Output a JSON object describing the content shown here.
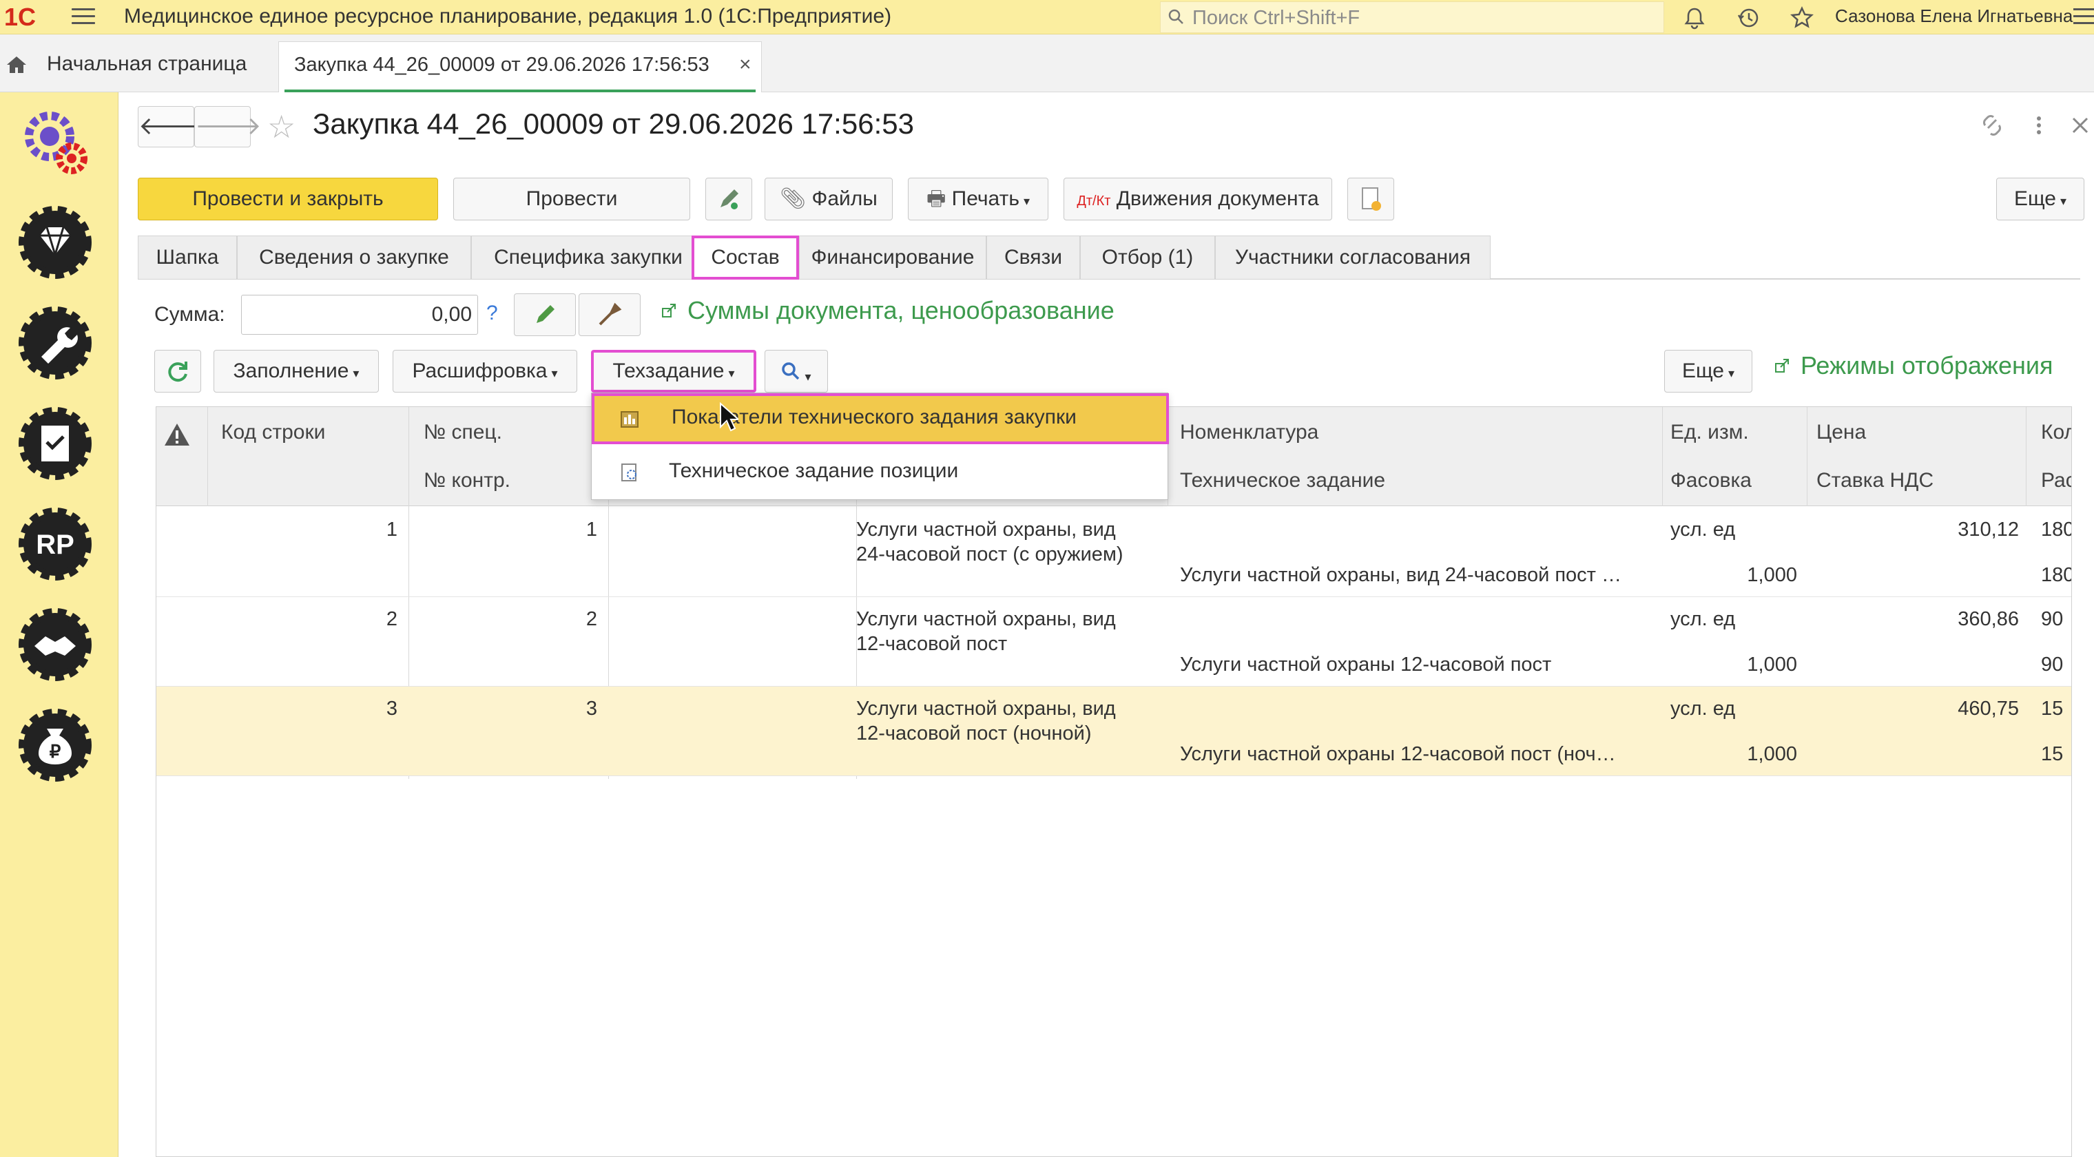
{
  "app": {
    "logo": "1С",
    "title": "Медицинское единое ресурсное планирование, редакция 1.0  (1С:Предприятие)",
    "search_placeholder": "Поиск Ctrl+Shift+F",
    "user": "Сазонова Елена Игнатьевна"
  },
  "tabs": {
    "home": "Начальная страница",
    "document": "Закупка 44_26_00009 от 29.06.2026 17:56:53",
    "close": "×"
  },
  "sidebar": {
    "items": [
      "settings-gear-icon",
      "diamond-gear-icon",
      "wrench-gear-icon",
      "document-gear-icon",
      "rp-gear-icon",
      "handshake-gear-icon",
      "money-bag-gear-icon"
    ],
    "rp_text": "RP"
  },
  "header": {
    "back": "🡐",
    "forward": "🡒",
    "title": "Закупка 44_26_00009 от 29.06.2026 17:56:53"
  },
  "toolbar": {
    "post_close": "Провести и закрыть",
    "post": "Провести",
    "files": "Файлы",
    "print": "Печать",
    "movements": "Движения документа",
    "more": "Еще"
  },
  "form_tabs": [
    "Шапка",
    "Сведения о закупке",
    "Специфика закупки",
    "Состав",
    "Финансирование",
    "Связи",
    "Отбор (1)",
    "Участники согласования"
  ],
  "active_tab": "Состав",
  "sum": {
    "label": "Сумма:",
    "value": "0,00",
    "help": "?",
    "link": "Суммы документа, ценообразование"
  },
  "table_toolbar": {
    "fill": "Заполнение",
    "decode": "Расшифровка",
    "tech": "Техзадание",
    "more": "Еще",
    "modes_link": "Режимы отображения"
  },
  "dropdown": {
    "items": [
      "Показатели технического задания закупки",
      "Техническое задание позиции"
    ]
  },
  "table": {
    "headers": {
      "code": "Код строки",
      "spec": "№ спец.",
      "contract": "№ контр.",
      "nomenclature": "Номенклатура",
      "tech_task": "Техническое задание",
      "unit": "Ед. изм.",
      "packing": "Фасовка",
      "price": "Цена",
      "vat": "Ставка НДС",
      "qty": "Кол",
      "distr": "Рас"
    },
    "rows": [
      {
        "code": "1",
        "spec": "1",
        "name1": "Услуги частной охраны, вид",
        "name2": "24-часовой пост (с оружием)",
        "tech": "Услуги частной охраны, вид 24-часовой пост …",
        "unit": "усл. ед",
        "packing": "1,000",
        "price": "310,12",
        "qty": "180",
        "qty2": "180"
      },
      {
        "code": "2",
        "spec": "2",
        "name1": "Услуги частной охраны, вид",
        "name2": "12-часовой пост",
        "tech": "Услуги частной охраны 12-часовой пост",
        "unit": "усл. ед",
        "packing": "1,000",
        "price": "360,86",
        "qty": "90",
        "qty2": "90"
      },
      {
        "code": "3",
        "spec": "3",
        "name1": "Услуги частной охраны, вид",
        "name2": "12-часовой пост (ночной)",
        "tech": "Услуги частной охраны 12-часовой пост (ноч…",
        "unit": "усл. ед",
        "packing": "1,000",
        "price": "460,75",
        "qty": "15",
        "qty2": "15"
      }
    ]
  },
  "colors": {
    "accent_yellow": "#fbeea0",
    "primary_button": "#f7d73e",
    "link_green": "#3d9a4d",
    "highlight_magenta": "#e34ed1",
    "selected_row": "#fdf3cf"
  }
}
